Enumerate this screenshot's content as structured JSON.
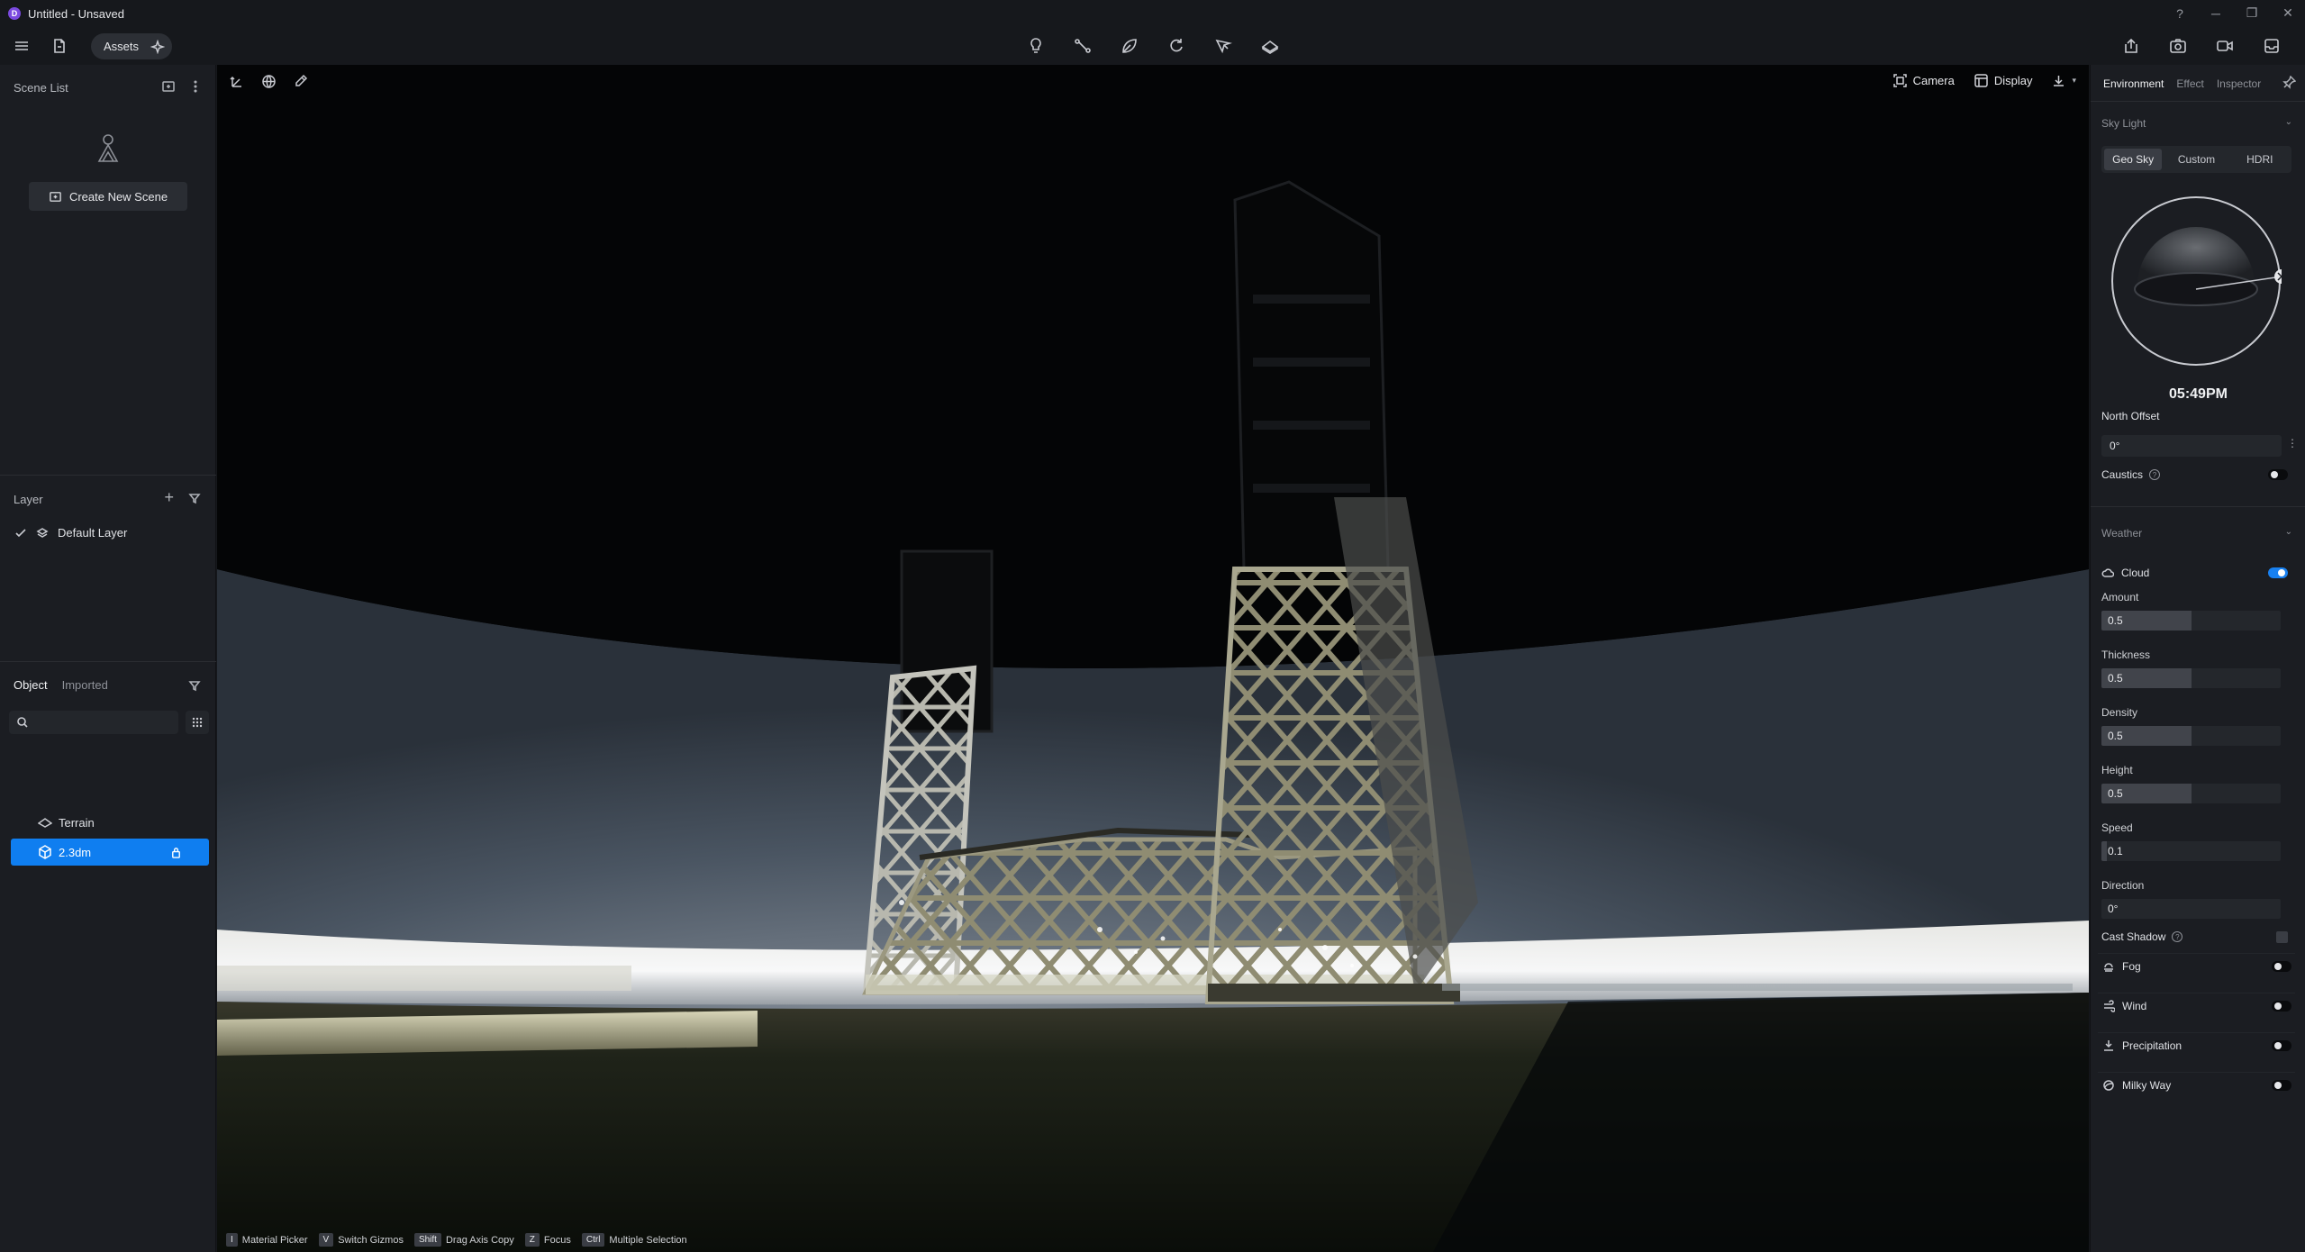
{
  "window": {
    "title": "Untitled - Unsaved",
    "logo_letter": "D",
    "controls": [
      "help-icon",
      "minimize-icon",
      "restore-icon",
      "close-icon"
    ]
  },
  "toolbar": {
    "assets_label": "Assets",
    "center_tools": [
      "light-bulb-icon",
      "path-icon",
      "leaf-icon",
      "refresh-icon",
      "people-icon",
      "terrain-icon"
    ],
    "right_tools": [
      "export-icon",
      "screenshot-icon",
      "video-icon",
      "inbox-icon"
    ]
  },
  "left_panel": {
    "scene_list_title": "Scene List",
    "create_scene_label": "Create New Scene",
    "layer_title": "Layer",
    "default_layer": "Default Layer",
    "tabs": {
      "object": "Object",
      "imported": "Imported"
    },
    "search": {
      "value": "",
      "placeholder": ""
    },
    "objects": [
      {
        "name": "Terrain",
        "icon": "terrain-icon",
        "selected": false
      },
      {
        "name": "2.3dm",
        "icon": "cube-icon",
        "selected": true,
        "locked": true
      }
    ]
  },
  "viewport": {
    "camera_label": "Camera",
    "display_label": "Display",
    "hints": [
      {
        "key": "I",
        "label": "Material Picker"
      },
      {
        "key": "V",
        "label": "Switch Gizmos"
      },
      {
        "key": "Shift",
        "label": "Drag Axis Copy"
      },
      {
        "key": "Z",
        "label": "Focus"
      },
      {
        "key": "Ctrl",
        "label": "Multiple Selection"
      }
    ]
  },
  "right_panel": {
    "tabs": {
      "environment": "Environment",
      "effect": "Effect",
      "inspector": "Inspector"
    },
    "sky_light": {
      "title": "Sky Light",
      "modes": [
        "Geo Sky",
        "Custom",
        "HDRI"
      ],
      "active_mode": "Geo Sky",
      "time": "05:49PM",
      "north_offset_label": "North Offset",
      "north_offset": "0°",
      "caustics_label": "Caustics",
      "caustics_on": false
    },
    "weather": {
      "title": "Weather",
      "cloud_label": "Cloud",
      "cloud_on": true,
      "amount_label": "Amount",
      "amount": "0.5",
      "thickness_label": "Thickness",
      "thickness": "0.5",
      "density_label": "Density",
      "density": "0.5",
      "height_label": "Height",
      "height": "0.5",
      "speed_label": "Speed",
      "speed": "0.1",
      "direction_label": "Direction",
      "direction": "0°",
      "cast_shadow_label": "Cast Shadow",
      "cast_shadow_on": false,
      "fog_label": "Fog",
      "fog_on": false,
      "wind_label": "Wind",
      "wind_on": false,
      "precip_label": "Precipitation",
      "precip_on": false,
      "milky_label": "Milky Way",
      "milky_on": false
    }
  },
  "colors": {
    "accent": "#0f7ef0",
    "panel_bg": "#1b1d22",
    "app_bg": "#16181c",
    "logo": "#7b4ae0"
  }
}
